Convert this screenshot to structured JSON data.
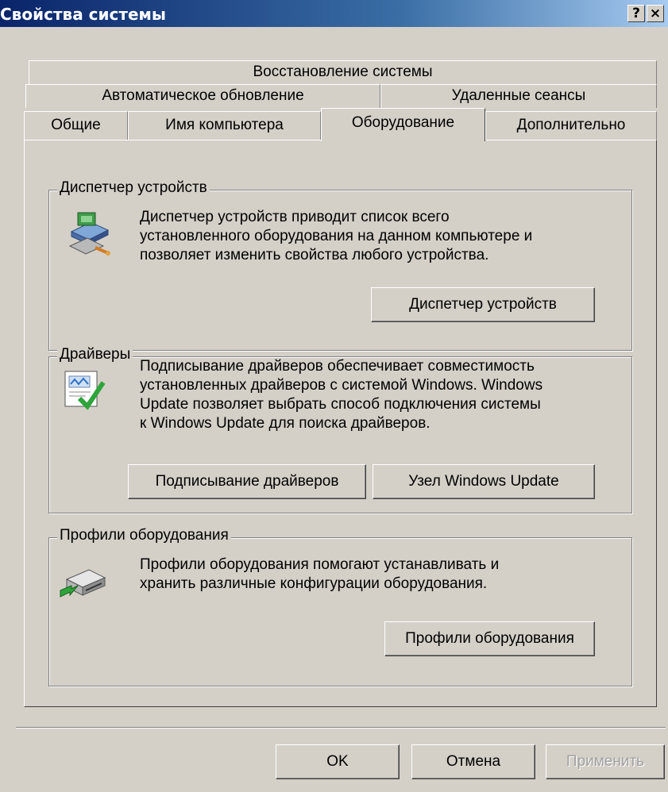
{
  "window": {
    "title": "Свойства системы"
  },
  "titlebar": {
    "help_label": "?",
    "close_label": "×"
  },
  "tabs": {
    "row3": [
      {
        "label": "Восстановление системы"
      }
    ],
    "row2": [
      {
        "label": "Автоматическое обновление"
      },
      {
        "label": "Удаленные сеансы"
      }
    ],
    "row1": [
      {
        "label": "Общие"
      },
      {
        "label": "Имя компьютера"
      },
      {
        "label": "Оборудование",
        "active": true
      },
      {
        "label": "Дополнительно"
      }
    ]
  },
  "device_manager": {
    "title": "Диспетчер устройств",
    "description_lines": [
      "Диспетчер устройств приводит список всего",
      "установленного оборудования на данном компьютере и",
      "позволяет изменить свойства любого устройства."
    ],
    "button_label": "Диспетчер устройств"
  },
  "drivers": {
    "title": "Драйверы",
    "description_lines": [
      "Подписывание драйверов обеспечивает совместимость",
      "установленных драйверов с системой Windows.  Windows",
      "Update позволяет выбрать способ подключения системы",
      "к Windows Update для поиска драйверов."
    ],
    "signing_button_label": "Подписывание драйверов",
    "update_button_label": "Узел Windows Update"
  },
  "hardware_profiles": {
    "title": "Профили оборудования",
    "description_lines": [
      "Профили оборудования помогают устанавливать и",
      "хранить различные конфигурации оборудования."
    ],
    "button_label": "Профили оборудования"
  },
  "footer": {
    "ok_label": "OK",
    "cancel_label": "Отмена",
    "apply_label": "Применить",
    "apply_enabled": false
  },
  "icons": {
    "device_manager": "device-manager-icon",
    "drivers": "driver-signing-icon",
    "profiles": "hardware-profile-icon"
  }
}
